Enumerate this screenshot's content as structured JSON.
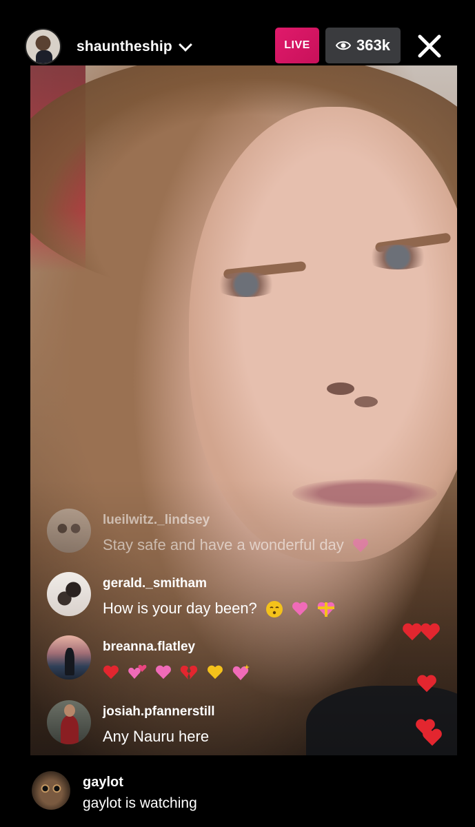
{
  "header": {
    "host_username": "shauntheship",
    "live_badge": "LIVE",
    "viewer_count": "363k",
    "icons": [
      "chevron-down-icon",
      "eye-icon",
      "close-icon"
    ]
  },
  "comments": [
    {
      "username": "lueilwitz._lindsey",
      "text": "Stay safe and have a wonderful day",
      "emojis": [
        "pink-heart"
      ]
    },
    {
      "username": "gerald._smitham",
      "text": "How is your day been?",
      "emojis": [
        "kissing-face",
        "pink-heart",
        "heart-with-ribbon"
      ]
    },
    {
      "username": "breanna.flatley",
      "emojis": [
        "red-heart",
        "revolving-hearts",
        "pink-heart",
        "broken-heart",
        "yellow-heart",
        "sparkling-heart"
      ]
    },
    {
      "username": "josiah.pfannerstill",
      "text": "Any Nauru here"
    }
  ],
  "viewer_event": {
    "username": "gaylot",
    "text": "gaylot is watching"
  },
  "colors": {
    "live_badge": "#e01a6b",
    "viewer_pill": "#3a3b3e",
    "background": "#000000",
    "float_heart": "#e3262f",
    "pink_heart": "#f06bb8",
    "yellow_heart": "#f4c21b"
  }
}
